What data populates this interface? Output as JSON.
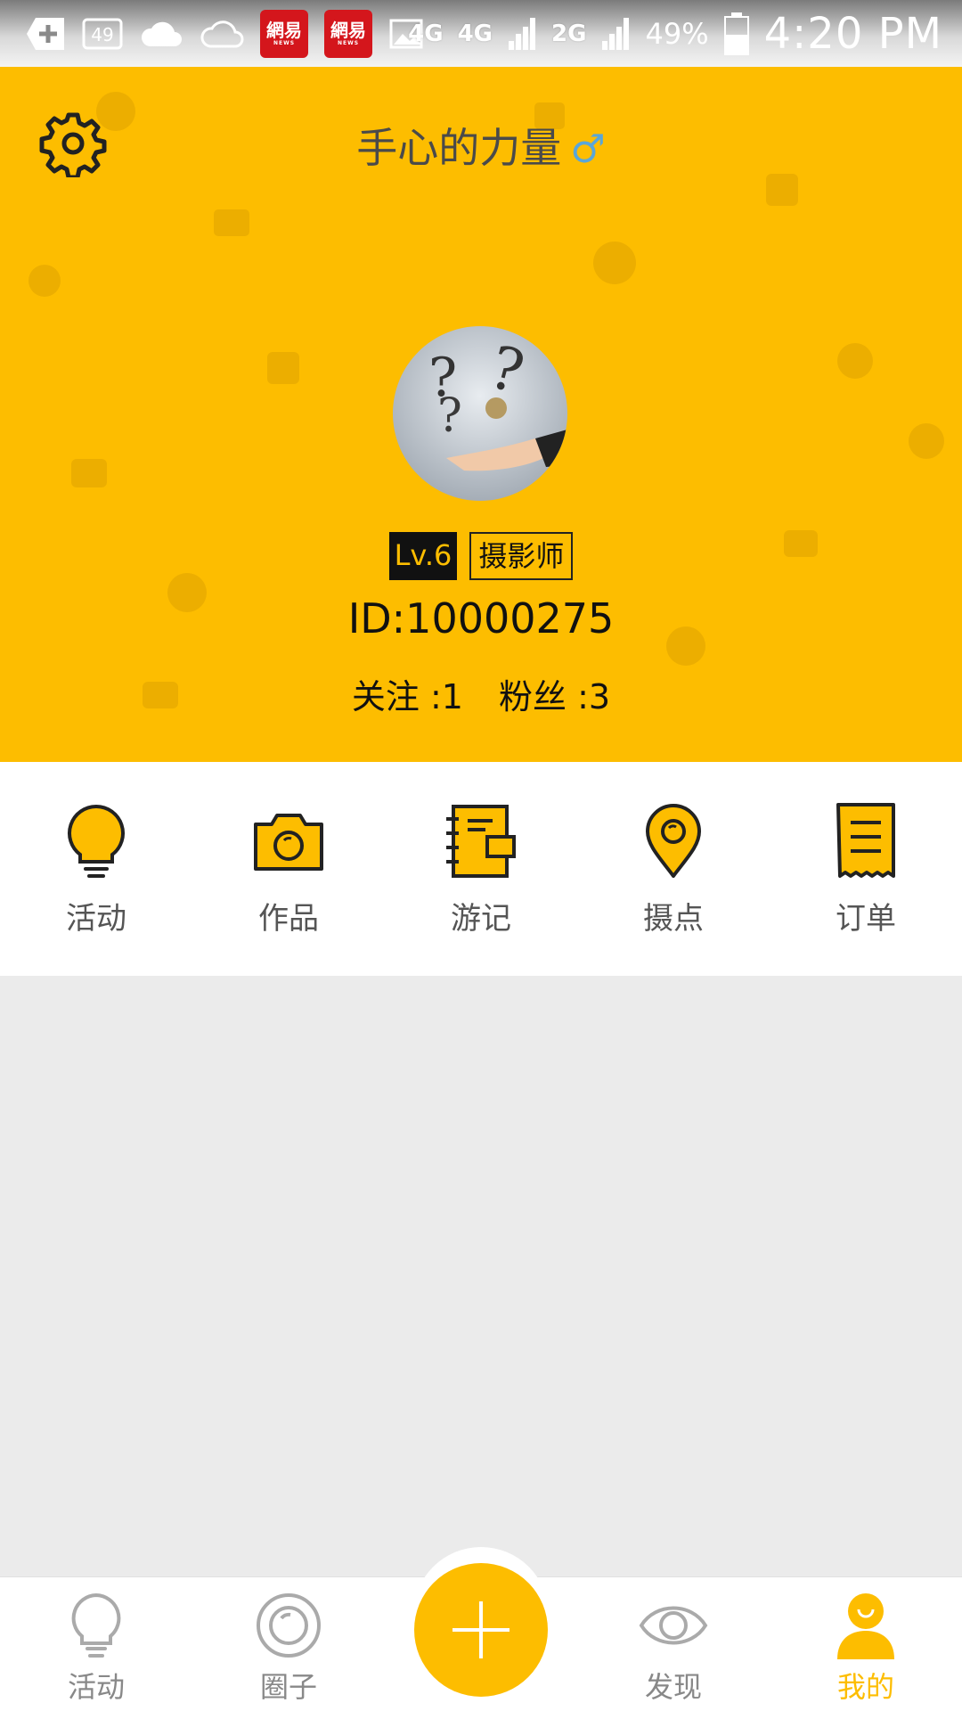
{
  "status_bar": {
    "notification_badge": "49",
    "netease_logo": "網易",
    "netease_sub": "NEWS",
    "net1": "4G",
    "net2": "4G",
    "net3": "2G",
    "battery": "49%",
    "time": "4:20 PM"
  },
  "profile": {
    "name": "手心的力量",
    "gender_symbol": "♂",
    "level": "Lv.6",
    "role": "摄影师",
    "id_text": "ID:10000275",
    "following_label": "关注 :1",
    "followers_label": "粉丝 :3"
  },
  "menu": {
    "items": [
      {
        "label": "活动",
        "icon": "lightbulb-icon"
      },
      {
        "label": "作品",
        "icon": "camera-icon"
      },
      {
        "label": "游记",
        "icon": "notebook-icon"
      },
      {
        "label": "摄点",
        "icon": "location-pin-icon"
      },
      {
        "label": "订单",
        "icon": "receipt-icon"
      }
    ]
  },
  "bottom_nav": {
    "items": [
      {
        "label": "活动",
        "icon": "lightbulb-icon"
      },
      {
        "label": "圈子",
        "icon": "circle-icon"
      },
      {
        "label": "发现",
        "icon": "eye-icon"
      },
      {
        "label": "我的",
        "icon": "user-icon"
      }
    ],
    "active": "我的"
  },
  "colors": {
    "brand_yellow": "#fdbd00",
    "text_dark": "#111111",
    "text_gray": "#555555",
    "inactive_nav": "#888888"
  }
}
